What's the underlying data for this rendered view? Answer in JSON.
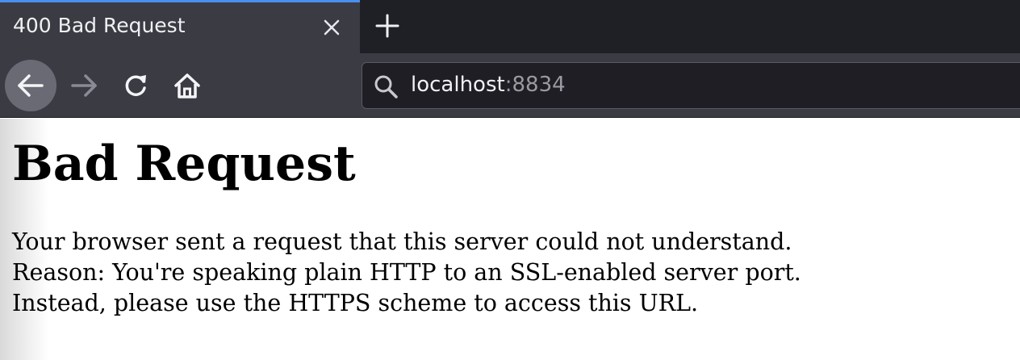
{
  "tab": {
    "title": "400 Bad Request",
    "close_icon": "close-icon",
    "new_tab_icon": "plus-icon",
    "accent_color": "#4a8ef0"
  },
  "toolbar": {
    "back_icon": "arrow-left-icon",
    "forward_icon": "arrow-right-icon",
    "reload_icon": "reload-icon",
    "home_icon": "home-icon"
  },
  "urlbar": {
    "search_icon": "search-icon",
    "host": "localhost",
    "port": ":8834"
  },
  "page": {
    "heading": "Bad Request",
    "lines": [
      "Your browser sent a request that this server could not understand.",
      "Reason: You're speaking plain HTTP to an SSL-enabled server port.",
      "Instead, please use the HTTPS scheme to access this URL."
    ]
  }
}
